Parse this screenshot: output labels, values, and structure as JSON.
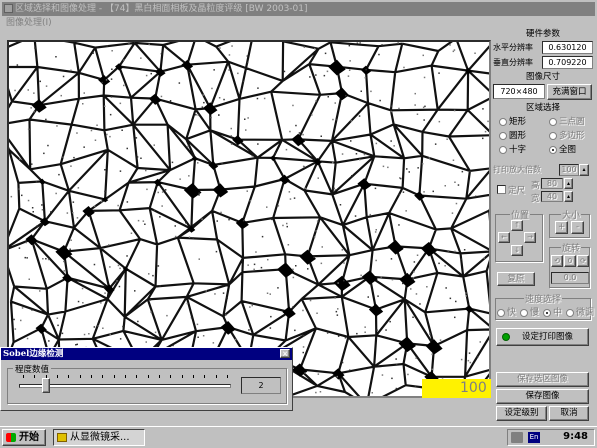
{
  "window": {
    "title": "区域选择和图像处理 - 【74】黑白相面相板及晶粒度评级 [BW 2003-01]"
  },
  "menu": [
    "图像处理(I)"
  ],
  "scale_label": "100",
  "hardware": {
    "title": "硬件参数",
    "hres_label": "水平分辨率",
    "hres_value": "0.630120",
    "vres_label": "垂直分辨率",
    "vres_value": "0.709220"
  },
  "image_size": {
    "title": "图像尺寸",
    "value": "720×480",
    "fill_button": "充满窗口"
  },
  "region": {
    "title": "区域选择",
    "options": [
      {
        "label": "矩形",
        "selected": false,
        "enabled": true
      },
      {
        "label": "三点圆",
        "selected": false,
        "enabled": false
      },
      {
        "label": "圆形",
        "selected": false,
        "enabled": true
      },
      {
        "label": "多边形",
        "selected": false,
        "enabled": false
      },
      {
        "label": "十字",
        "selected": false,
        "enabled": true
      },
      {
        "label": "全图",
        "selected": true,
        "enabled": true
      }
    ]
  },
  "print": {
    "magnify_label": "打印放大倍数",
    "magnify_value": "100",
    "fixed_label": "定尺",
    "height_label": "高",
    "height_value": "80",
    "width_label": "宽",
    "width_value": "40"
  },
  "position": {
    "title": "位置",
    "buttons": {
      "up": "↑",
      "left": "←",
      "right": "→",
      "down": "↓"
    },
    "reset": "复原"
  },
  "size": {
    "title": "大小",
    "plus": "+",
    "minus": "-"
  },
  "rotate": {
    "title": "旋转",
    "buttons": [
      "⟲",
      "0",
      "⟳"
    ],
    "value": "0.0"
  },
  "speed": {
    "title": "速度选择",
    "options": [
      {
        "label": "快",
        "selected": false
      },
      {
        "label": "慢",
        "selected": false
      },
      {
        "label": "中",
        "selected": true
      },
      {
        "label": "微调",
        "selected": false
      }
    ]
  },
  "actions": {
    "set_print": "设定打印图像",
    "save_selection": "保存选区图像",
    "save_image": "保存图像",
    "set_grade": "设定级别",
    "cancel": "取消"
  },
  "sobel": {
    "title": "Sobel边缘检测",
    "group_label": "程度数值",
    "value": "2",
    "ticks": 19,
    "slider_value": 2,
    "slider_max": 18
  },
  "taskbar": {
    "start": "开始",
    "task": "从显微镜采...",
    "time": "9:48",
    "tray_icons": [
      "volume-icon",
      "ime-icon"
    ]
  },
  "colors": {
    "titlebar_inactive": "#808080",
    "dialog_active": "#000080",
    "scale_bar": "#fff200",
    "indicator_green": "#00a000"
  }
}
